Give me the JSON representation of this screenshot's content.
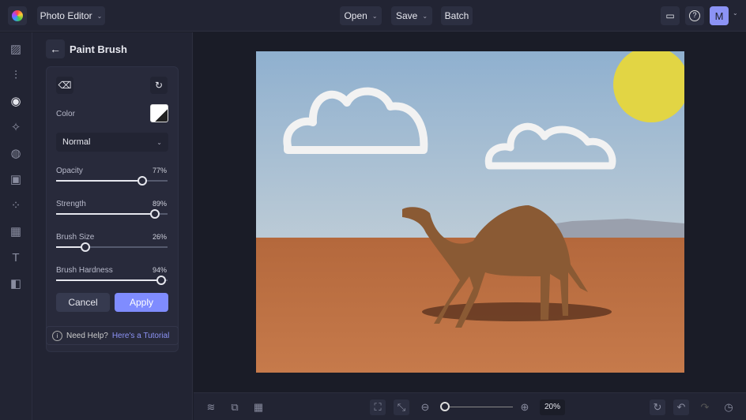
{
  "app": {
    "logo": "b",
    "mode_label": "Photo Editor"
  },
  "topbar": {
    "open_label": "Open",
    "save_label": "Save",
    "batch_label": "Batch",
    "avatar_initial": "M"
  },
  "panel": {
    "title": "Paint Brush",
    "color_label": "Color",
    "color_value": "#ffffff",
    "blend_mode": "Normal",
    "sliders": [
      {
        "label": "Opacity",
        "value": 77,
        "display": "77%"
      },
      {
        "label": "Strength",
        "value": 89,
        "display": "89%"
      },
      {
        "label": "Brush Size",
        "value": 26,
        "display": "26%"
      },
      {
        "label": "Brush Hardness",
        "value": 94,
        "display": "94%"
      }
    ],
    "cancel_label": "Cancel",
    "apply_label": "Apply",
    "help_text": "Need Help?",
    "help_link": "Here's a Tutorial"
  },
  "bottombar": {
    "zoom_display": "20%",
    "zoom_value": 20
  },
  "colors": {
    "accent": "#7f8cff",
    "bg": "#1b1d28"
  }
}
